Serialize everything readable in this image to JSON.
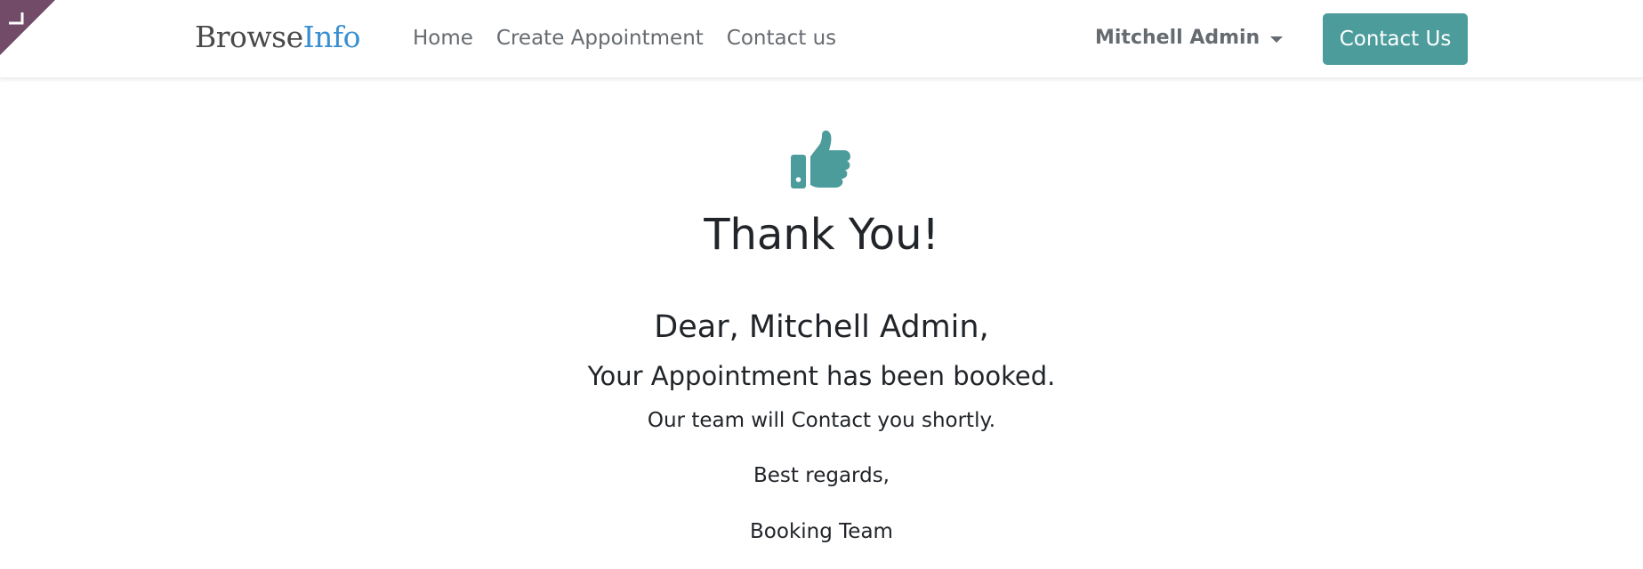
{
  "colors": {
    "brand_primary": "#4a4a4a",
    "brand_accent": "#3a8fd1",
    "button_accent": "#4d9c9c",
    "corner_badge": "#714b67"
  },
  "navbar": {
    "brand": {
      "part1": "Browse",
      "part2": "Info"
    },
    "links": [
      "Home",
      "Create Appointment",
      "Contact us"
    ],
    "user": "Mitchell Admin",
    "cta": "Contact Us"
  },
  "confirmation": {
    "icon": "thumbs-up-icon",
    "title": "Thank You!",
    "greeting": "Dear, Mitchell Admin,",
    "message": "Your Appointment has been booked.",
    "followup": "Our team will Contact you shortly.",
    "signoff": "Best regards,",
    "team": "Booking Team"
  }
}
